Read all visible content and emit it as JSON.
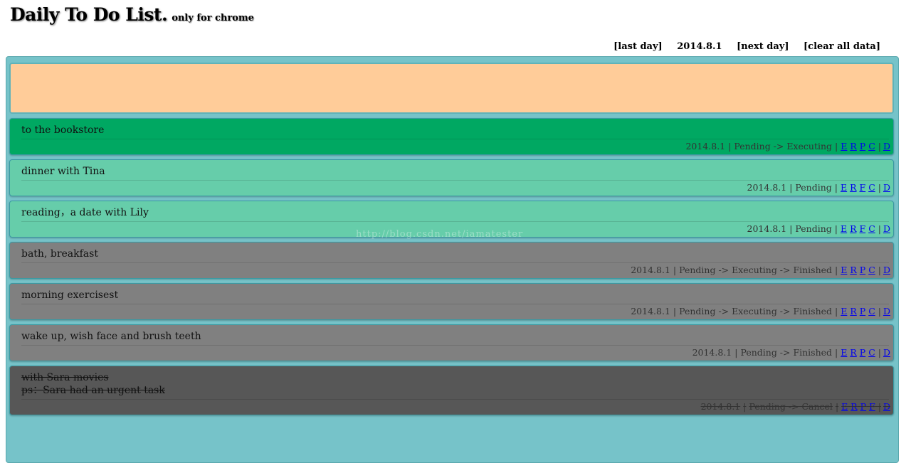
{
  "header": {
    "title": "Daily To Do List.",
    "subtitle": "only for chrome"
  },
  "nav": {
    "last_day": "[last day]",
    "date": "2014.8.1",
    "next_day": "[next day]",
    "clear": "[clear all data]"
  },
  "tasks": [
    {
      "text": "to the bookstore",
      "text2": "",
      "date": "2014.8.1",
      "status": "Pending -> Executing",
      "state": "executing",
      "actions": [
        "E",
        "R",
        "P",
        "C"
      ]
    },
    {
      "text": "dinner with Tina",
      "text2": "",
      "date": "2014.8.1",
      "status": "Pending",
      "state": "pending",
      "actions": [
        "E",
        "R",
        "F",
        "C"
      ]
    },
    {
      "text": "reading，a date with Lily",
      "text2": "",
      "date": "2014.8.1",
      "status": "Pending",
      "state": "pending",
      "actions": [
        "E",
        "R",
        "F",
        "C"
      ]
    },
    {
      "text": "bath, breakfast",
      "text2": "",
      "date": "2014.8.1",
      "status": "Pending -> Executing -> Finished",
      "state": "finished",
      "actions": [
        "E",
        "R",
        "P",
        "C"
      ]
    },
    {
      "text": "morning exercisest",
      "text2": "",
      "date": "2014.8.1",
      "status": "Pending -> Executing -> Finished",
      "state": "finished",
      "actions": [
        "E",
        "R",
        "P",
        "C"
      ]
    },
    {
      "text": "wake up, wish face and brush teeth",
      "text2": "",
      "date": "2014.8.1",
      "status": "Pending -> Finished",
      "state": "finished",
      "actions": [
        "E",
        "R",
        "P",
        "C"
      ]
    },
    {
      "text": "with Sara movies",
      "text2": "ps：Sara had an urgent task",
      "date": "2014.8.1",
      "status": "Pending -> Cancel",
      "state": "cancel",
      "actions": [
        "E",
        "R",
        "P",
        "F"
      ]
    }
  ],
  "delete_label": "D",
  "separator": "|",
  "watermark": "http://blog.csdn.net/iamatester",
  "colors": {
    "board": "#76c3c9",
    "input": "#ffcc99",
    "executing": "#00a862",
    "pending": "#66cdaa",
    "finished": "#808080",
    "cancel": "#575757",
    "link": "#0000ee"
  }
}
